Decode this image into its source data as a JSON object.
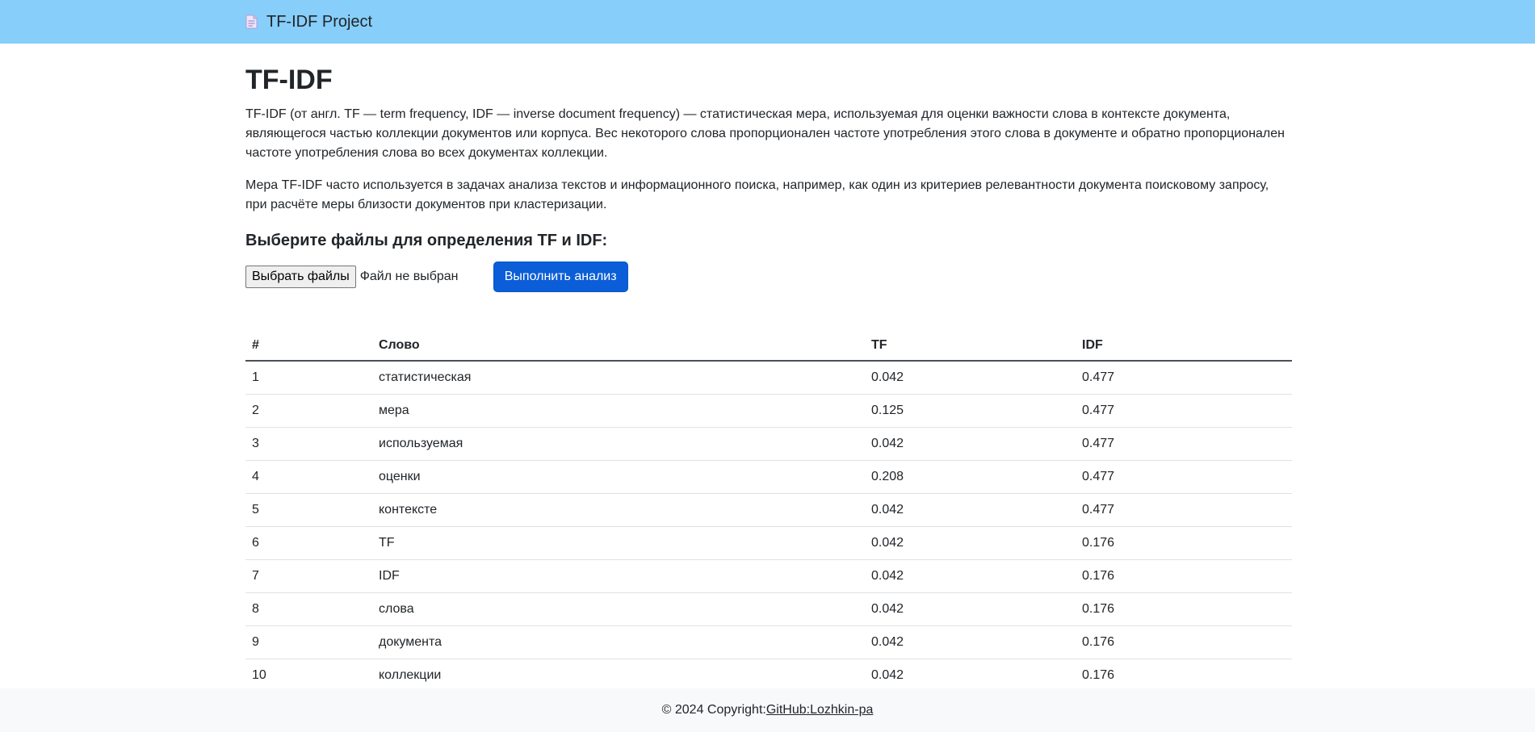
{
  "navbar": {
    "brand": "TF-IDF Project",
    "brand_icon": "document-icon"
  },
  "main": {
    "title": "TF-IDF",
    "paragraph1": "TF-IDF (от англ. TF — term frequency, IDF — inverse document frequency) — статистическая мера, используемая для оценки важности слова в контексте документа, являющегося частью коллекции документов или корпуса. Вес некоторого слова пропорционален частоте употребления этого слова в документе и обратно пропорционален частоте употребления слова во всех документах коллекции.",
    "paragraph2": "Мера TF-IDF часто используется в задачах анализа текстов и информационного поиска, например, как один из критериев релевантности документа поисковому запросу, при расчёте меры близости документов при кластеризации.",
    "form_heading": "Выберите файлы для определения TF и IDF:",
    "file_button": "Выбрать файлы",
    "file_status": "Файл не выбран",
    "submit_button": "Выполнить анализ"
  },
  "table": {
    "headers": [
      "#",
      "Слово",
      "TF",
      "IDF"
    ],
    "rows": [
      [
        "1",
        "статистическая",
        "0.042",
        "0.477"
      ],
      [
        "2",
        "мера",
        "0.125",
        "0.477"
      ],
      [
        "3",
        "используемая",
        "0.042",
        "0.477"
      ],
      [
        "4",
        "оценки",
        "0.208",
        "0.477"
      ],
      [
        "5",
        "контексте",
        "0.042",
        "0.477"
      ],
      [
        "6",
        "TF",
        "0.042",
        "0.176"
      ],
      [
        "7",
        "IDF",
        "0.042",
        "0.176"
      ],
      [
        "8",
        "слова",
        "0.042",
        "0.176"
      ],
      [
        "9",
        "документа",
        "0.042",
        "0.176"
      ],
      [
        "10",
        "коллекции",
        "0.042",
        "0.176"
      ]
    ]
  },
  "footer": {
    "copyright": "© 2024 Copyright: ",
    "link": "GitHub:Lozhkin-pa"
  },
  "colors": {
    "navbar_bg": "#87cefa",
    "primary_button": "#0b5ed7",
    "footer_bg": "#f8f9fa"
  }
}
